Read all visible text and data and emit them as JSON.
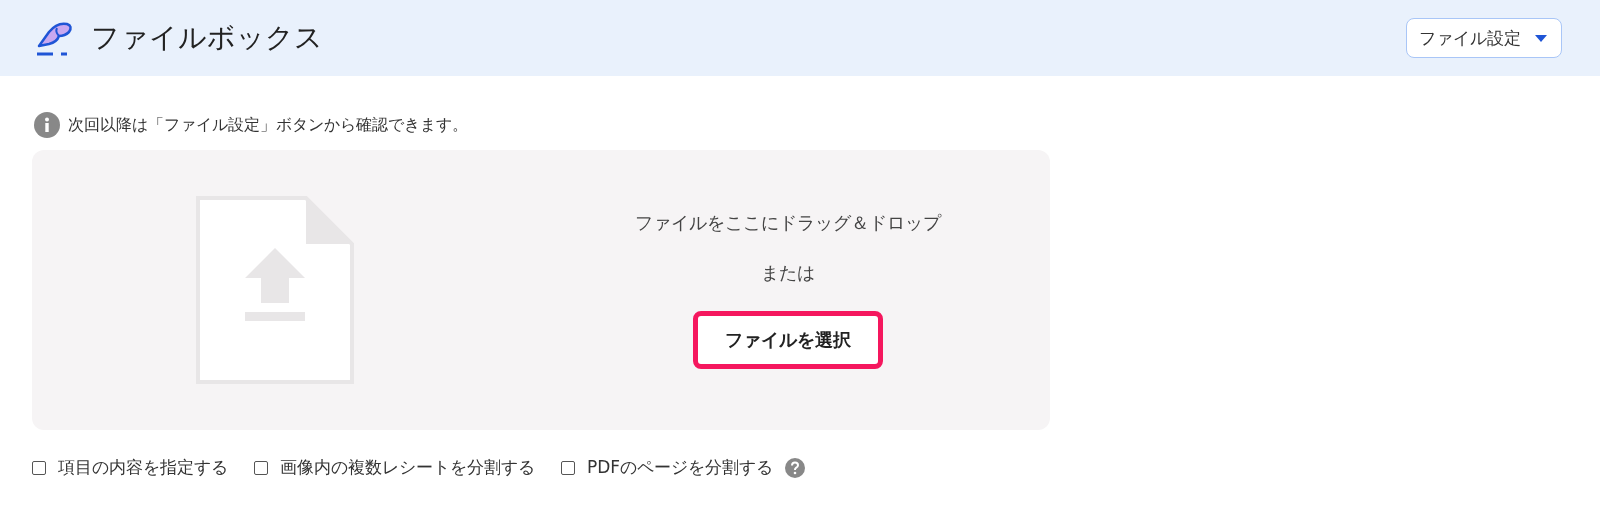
{
  "header": {
    "title": "ファイルボックス",
    "settings_button": {
      "label": "ファイル設定"
    }
  },
  "info": {
    "text": "次回以降は「ファイル設定」ボタンから確認できます。"
  },
  "dropzone": {
    "instruction": "ファイルをここにドラッグ＆ドロップ",
    "or": "または",
    "button": {
      "label": "ファイルを選択",
      "highlighted": true
    }
  },
  "options": [
    {
      "label": "項目の内容を指定する",
      "checked": false,
      "help": false
    },
    {
      "label": "画像内の複数レシートを分割する",
      "checked": false,
      "help": false
    },
    {
      "label": "PDFのページを分割する",
      "checked": false,
      "help": true
    }
  ]
}
